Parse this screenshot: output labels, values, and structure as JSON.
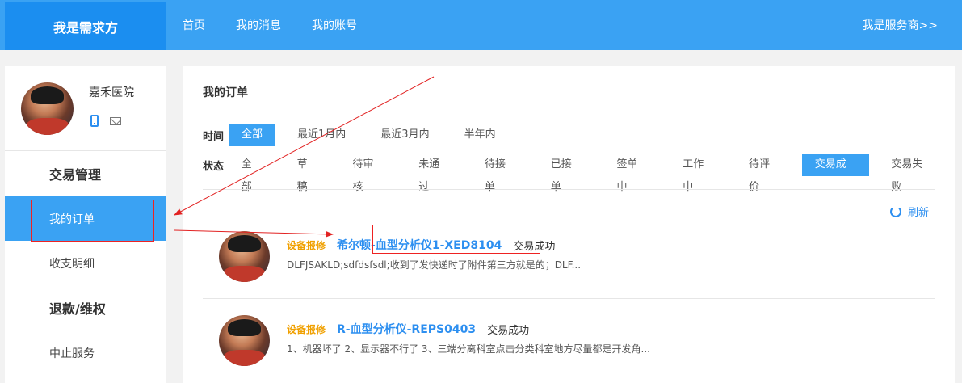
{
  "header": {
    "brand": "我是需求方",
    "nav": [
      "首页",
      "我的消息",
      "我的账号"
    ],
    "switch_link": "我是服务商>>"
  },
  "sidebar": {
    "profile_name": "嘉禾医院",
    "groups": [
      {
        "title": "交易管理",
        "items": [
          "我的订单",
          "收支明细"
        ]
      },
      {
        "title": "退款/维权",
        "items": [
          "中止服务"
        ]
      }
    ]
  },
  "main": {
    "title": "我的订单",
    "time_filter": {
      "label": "时间",
      "options": [
        "全部",
        "最近1月内",
        "最近3月内",
        "半年内"
      ],
      "selected": "全部"
    },
    "status_filter": {
      "label": "状态",
      "options": [
        "全部",
        "草稿",
        "待审核",
        "未通过",
        "待接单",
        "已接单",
        "签单中",
        "工作中",
        "待评价",
        "交易成功",
        "交易失败"
      ],
      "selected": "交易成功"
    },
    "refresh_label": "刷新",
    "orders": [
      {
        "tag": "设备报修",
        "title": "希尔顿-血型分析仪1-XED8104",
        "status": "交易成功",
        "desc": "DLFJSAKLD;sdfdsfsdl;收到了发快递时了附件第三方就是的；DLF..."
      },
      {
        "tag": "设备报修",
        "title": "R-血型分析仪-REPS0403",
        "status": "交易成功",
        "desc": "1、机器坏了 2、显示器不行了 3、三端分离科室点击分类科室地方尽量都是开发角..."
      }
    ]
  },
  "colors": {
    "primary": "#3aa2f3",
    "brand_bg": "#1b8ef0",
    "tag": "#f0a000",
    "link": "#2d8ff0",
    "annotation": "#e22222"
  }
}
